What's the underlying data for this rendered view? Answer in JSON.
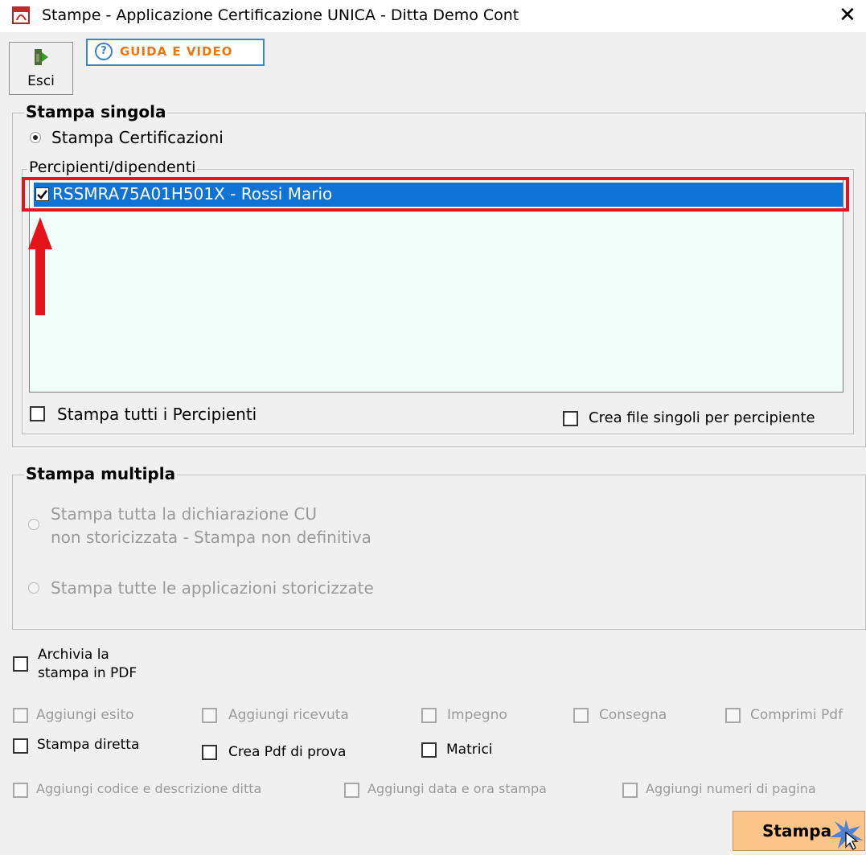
{
  "window": {
    "title": "Stampe - Applicazione Certificazione UNICA - Ditta  Demo Cont"
  },
  "toolbar": {
    "esci_label": "Esci",
    "guida_label": "GUIDA E VIDEO"
  },
  "stampa_singola": {
    "legend": "Stampa singola",
    "radio_certificazioni": "Stampa Certificazioni",
    "list_legend": "Percipienti/dipendenti",
    "list_items": [
      {
        "label": "RSSMRA75A01H501X - Rossi Mario",
        "checked": true
      }
    ],
    "stampa_tutti_label": "Stampa tutti i Percipienti",
    "crea_file_singoli_label": "Crea file singoli per percipiente"
  },
  "stampa_multipla": {
    "legend": "Stampa multipla",
    "option1_line1": "Stampa tutta la dichiarazione CU",
    "option1_line2": "non storicizzata - Stampa non definitiva",
    "option2": "Stampa tutte le applicazioni storicizzate"
  },
  "options": {
    "archivia_line1": "Archivia la",
    "archivia_line2": "stampa in PDF",
    "aggiungi_esito": "Aggiungi esito",
    "aggiungi_ricevuta": "Aggiungi ricevuta",
    "impegno": "Impegno",
    "consegna": "Consegna",
    "comprimi_pdf": "Comprimi Pdf",
    "stampa_diretta": "Stampa diretta",
    "crea_pdf_prova": "Crea Pdf di prova",
    "matrici": "Matrici",
    "aggiungi_codice": "Aggiungi codice e descrizione ditta",
    "aggiungi_data": "Aggiungi data e ora stampa",
    "aggiungi_numeri": "Aggiungi numeri di pagina"
  },
  "actions": {
    "stampa_label": "Stampa"
  },
  "colors": {
    "selection": "#0f73d6",
    "highlight": "#e5141b",
    "list_background": "#f0fffa",
    "stampa_button": "#fbc58a",
    "guida_text": "#f0760c"
  }
}
